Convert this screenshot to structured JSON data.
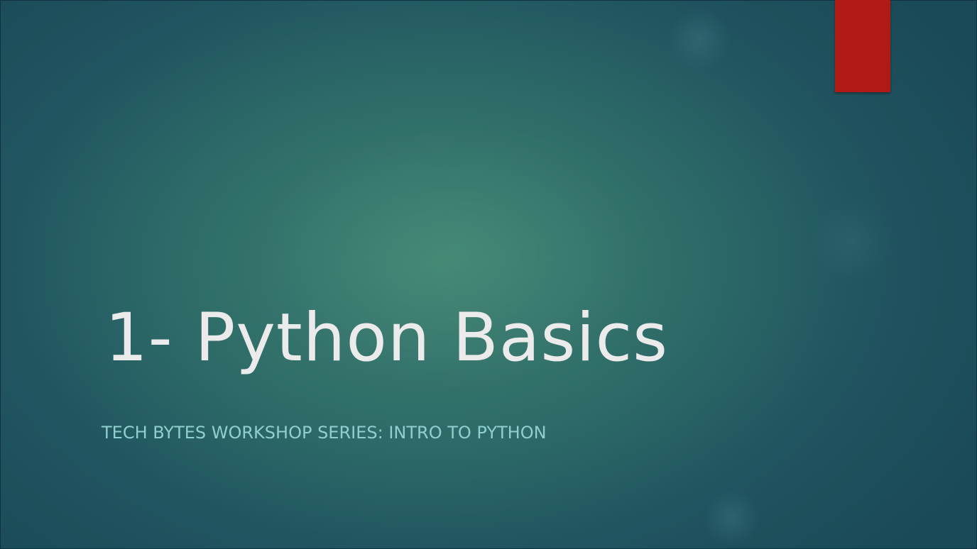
{
  "slide": {
    "title": "1- Python Basics",
    "subtitle": "TECH BYTES WORKSHOP SERIES: INTRO TO PYTHON"
  },
  "colors": {
    "background_center": "#3b7b70",
    "background_edge": "#1a4957",
    "accent_tab": "#b01a16",
    "title_text": "#ebebeb",
    "subtitle_text": "#8fcfcf"
  }
}
